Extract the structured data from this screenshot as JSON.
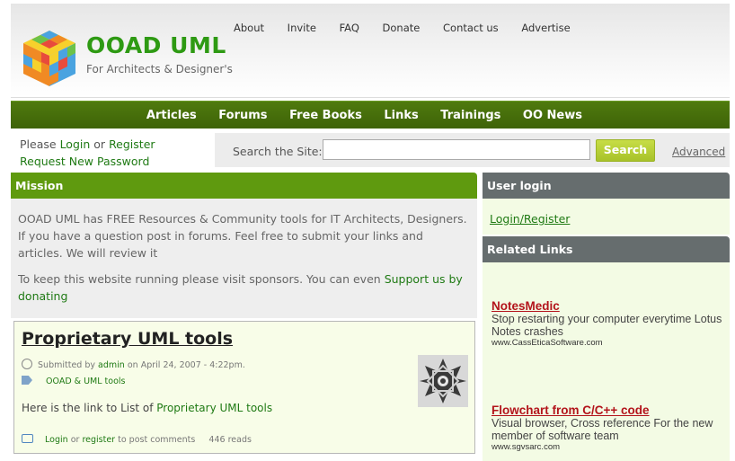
{
  "header": {
    "site_name": "OOAD UML",
    "tagline": "For Architects & Designer's",
    "topnav": [
      "About",
      "Invite",
      "FAQ",
      "Donate",
      "Contact us",
      "Advertise"
    ]
  },
  "mainnav": [
    "Articles",
    "Forums",
    "Free Books",
    "Links",
    "Trainings",
    "OO News"
  ],
  "login_links": {
    "please": "Please",
    "login": "Login",
    "or": "or",
    "register": "Register",
    "request_password": "Request New Password"
  },
  "search": {
    "label": "Search the Site:",
    "value": "",
    "button": "Search",
    "advanced": "Advanced"
  },
  "mission": {
    "title": "Mission",
    "p1": "OOAD UML has FREE Resources & Community tools for IT Architects, Designers. If you have a question post in forums. Feel free to submit your links and articles. We will review it",
    "p2_text": "To keep this website running please visit sponsors. You can even",
    "p2_link": "Support us by donating"
  },
  "node": {
    "title": "Proprietary UML tools",
    "submitted_by": "Submitted by",
    "author": "admin",
    "date": "on April 24, 2007 - 4:22pm.",
    "tag": "OOAD & UML tools",
    "text": "Here is the link to List of",
    "text_link": "Proprietary UML tools",
    "login": "Login",
    "or": "or",
    "register": "register",
    "to_post": "to post comments",
    "reads": "446 reads"
  },
  "sidebar": {
    "user_login_title": "User login",
    "user_login_link": "Login/Register",
    "related_title": "Related Links",
    "ads": [
      {
        "title": "NotesMedic",
        "text": "Stop restarting your computer everytime Lotus Notes crashes",
        "url": "www.CassEticaSoftware.com"
      },
      {
        "title": "Flowchart from C/C++ code",
        "text": "Visual browser, Cross reference For the new member of software team",
        "url": "www.sgvsarc.com"
      }
    ]
  },
  "colors": {
    "brand_green": "#2e9a13",
    "nav_green": "#4f7a0e",
    "mission_green": "#5f9a0f",
    "sidebar_grey": "#666d6e",
    "ad_red": "#b3141b"
  }
}
